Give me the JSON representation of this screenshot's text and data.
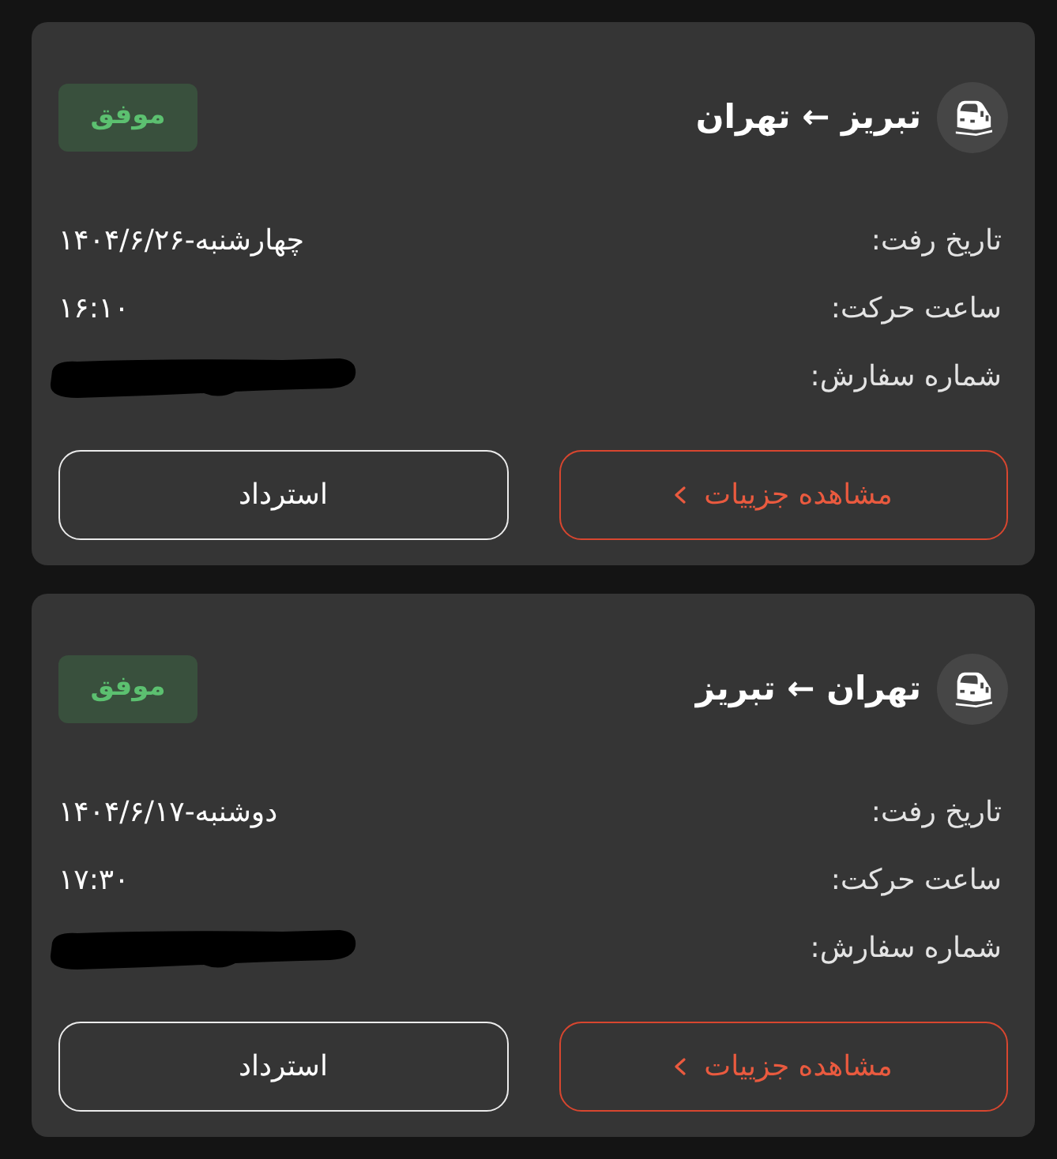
{
  "trips": [
    {
      "route": "تبریز ← تهران",
      "status": {
        "kind": "success",
        "label": "موفق"
      },
      "details": [
        {
          "label": "تاریخ رفت:",
          "value": "چهارشنبه-۱۴۰۴/۶/۲۶",
          "redacted": false
        },
        {
          "label": "ساعت حرکت:",
          "value": "۱۶:۱۰",
          "redacted": false
        },
        {
          "label": "شماره سفارش:",
          "redacted": true
        }
      ],
      "buttons": [
        {
          "kind": "primary",
          "label": "مشاهده جزییات"
        },
        {
          "kind": "secondary",
          "label": "استرداد"
        }
      ]
    },
    {
      "route": "تهران ← تبریز",
      "status": {
        "kind": "success",
        "label": "موفق"
      },
      "details": [
        {
          "label": "تاریخ رفت:",
          "value": "دوشنبه-۱۴۰۴/۶/۱۷",
          "redacted": false
        },
        {
          "label": "ساعت حرکت:",
          "value": "۱۷:۳۰",
          "redacted": false
        },
        {
          "label": "شماره سفارش:",
          "redacted": true
        }
      ],
      "buttons": [
        {
          "kind": "primary",
          "label": "مشاهده جزییات"
        },
        {
          "kind": "secondary",
          "label": "استرداد"
        }
      ]
    }
  ]
}
